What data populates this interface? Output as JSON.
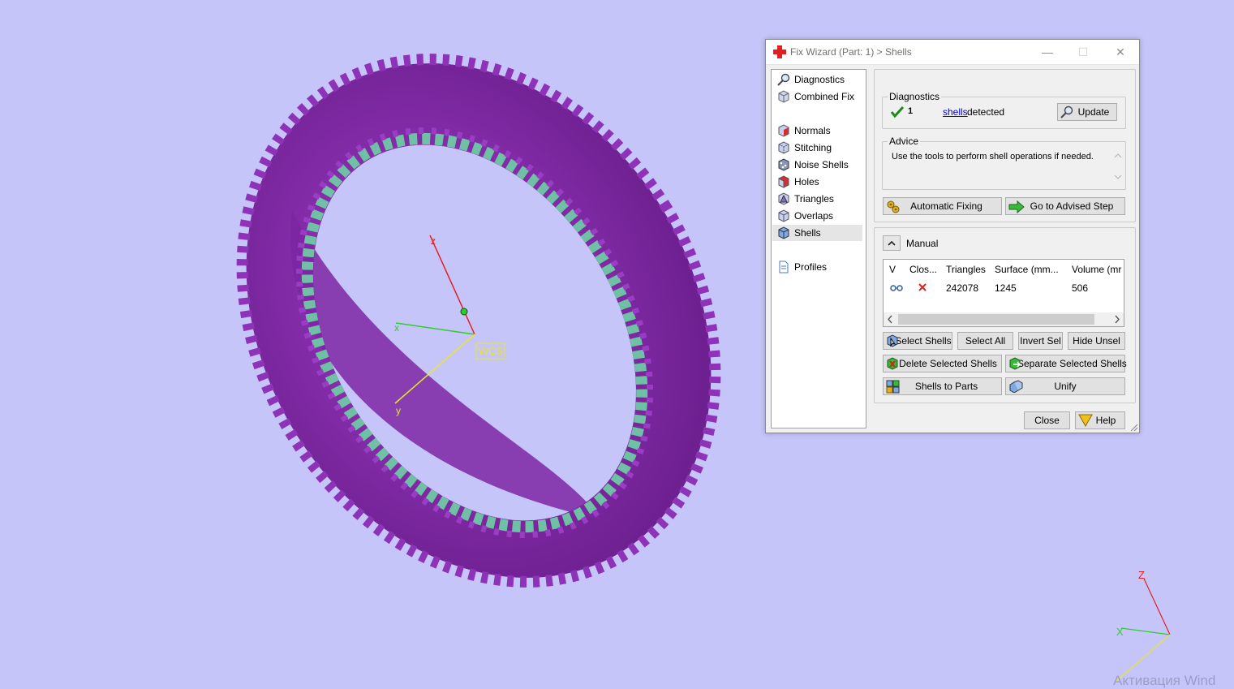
{
  "window": {
    "title": "Fix Wizard (Part: 1) > Shells",
    "minimize": "—",
    "maximize": "☐",
    "close": "✕"
  },
  "nav": {
    "items": [
      {
        "label": "Diagnostics",
        "icon": "magnifier-icon"
      },
      {
        "label": "Combined Fix",
        "icon": "cube-icon"
      },
      {
        "label": "Normals",
        "icon": "normals-cube-icon"
      },
      {
        "label": "Stitching",
        "icon": "stitching-cube-icon"
      },
      {
        "label": "Noise Shells",
        "icon": "noise-shells-icon"
      },
      {
        "label": "Holes",
        "icon": "holes-cube-icon"
      },
      {
        "label": "Triangles",
        "icon": "triangles-cube-icon"
      },
      {
        "label": "Overlaps",
        "icon": "overlaps-cube-icon"
      },
      {
        "label": "Shells",
        "icon": "shells-cube-icon"
      },
      {
        "label": "Profiles",
        "icon": "document-icon"
      }
    ],
    "active": "Shells"
  },
  "diagnostics": {
    "group_label": "Diagnostics",
    "count": "1",
    "link": "shells",
    "suffix": "detected",
    "update_label": "Update"
  },
  "advice": {
    "group_label": "Advice",
    "text": "Use the tools to perform shell operations if needed.",
    "automatic_fixing_label": "Automatic Fixing",
    "advised_step_label": "Go to Advised Step"
  },
  "manual": {
    "label": "Manual",
    "columns": [
      "V",
      "Clos...",
      "Triangles",
      "Surface (mm...",
      "Volume (mr"
    ],
    "rows": [
      {
        "triangles": "242078",
        "surface": "1245",
        "volume": "506"
      }
    ],
    "buttons": {
      "select_shells": "Select Shells",
      "select_all": "Select All",
      "invert_sel": "Invert Sel",
      "hide_unsel": "Hide Unsel",
      "delete_selected": "Delete Selected Shells",
      "separate_selected": "Separate Selected Shells",
      "shells_to_parts": "Shells to Parts",
      "unify": "Unify"
    }
  },
  "footer": {
    "close_label": "Close",
    "help_label": "Help"
  },
  "viewport": {
    "wcs_label": "WCS",
    "axis_x": "x",
    "axis_y": "y",
    "axis_z": "z",
    "mini_axis_x": "X",
    "mini_axis_z": "Z",
    "watermark": "Активация Wind"
  },
  "colors": {
    "background": "#c6c5fa",
    "ring": "#8a2cb0",
    "bead_teal": "#6fc1a6",
    "axis_x": "#2ecc2e",
    "axis_y": "#e6e62e",
    "axis_z": "#e02020"
  }
}
